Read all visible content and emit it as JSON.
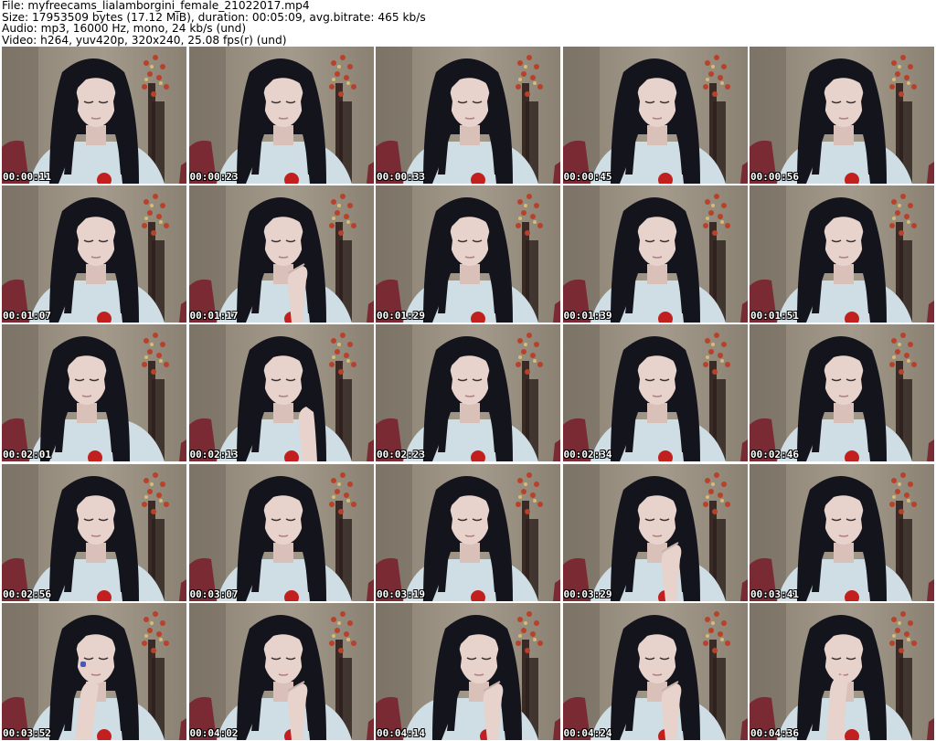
{
  "header": {
    "file_line": "File: myfreecams_lialamborgini_female_21022017.mp4",
    "size_line": "Size: 17953509 bytes (17.12 MiB), duration: 00:05:09, avg.bitrate: 465 kb/s",
    "audio_line": "Audio: mp3, 16000 Hz, mono, 24 kb/s (und)",
    "video_line": "Video: h264, yuv420p, 320x240, 25.08 fps(r) (und)"
  },
  "frames": [
    {
      "time": "00:00:11",
      "hand": "none",
      "tilt": 0
    },
    {
      "time": "00:00:23",
      "hand": "none",
      "tilt": 0
    },
    {
      "time": "00:00:33",
      "hand": "none",
      "tilt": 0
    },
    {
      "time": "00:00:45",
      "hand": "none",
      "tilt": 0
    },
    {
      "time": "00:00:56",
      "hand": "none",
      "tilt": 0
    },
    {
      "time": "00:01:07",
      "hand": "none",
      "tilt": 0
    },
    {
      "time": "00:01:17",
      "hand": "chin",
      "tilt": 0
    },
    {
      "time": "00:01:29",
      "hand": "none",
      "tilt": 0
    },
    {
      "time": "00:01:39",
      "hand": "none",
      "tilt": 0
    },
    {
      "time": "00:01:51",
      "hand": "none",
      "tilt": 0
    },
    {
      "time": "00:02:01",
      "hand": "none",
      "tilt": -1
    },
    {
      "time": "00:02:13",
      "hand": "hair",
      "tilt": 0
    },
    {
      "time": "00:02:23",
      "hand": "none",
      "tilt": 0
    },
    {
      "time": "00:02:34",
      "hand": "none",
      "tilt": 0
    },
    {
      "time": "00:02:46",
      "hand": "none",
      "tilt": 0
    },
    {
      "time": "00:02:56",
      "hand": "none",
      "tilt": 0
    },
    {
      "time": "00:03:07",
      "hand": "none",
      "tilt": 0
    },
    {
      "time": "00:03:19",
      "hand": "none",
      "tilt": 0
    },
    {
      "time": "00:03:29",
      "hand": "chin",
      "tilt": 0
    },
    {
      "time": "00:03:41",
      "hand": "none",
      "tilt": 0
    },
    {
      "time": "00:03:52",
      "hand": "mouth",
      "tilt": 0
    },
    {
      "time": "00:04:02",
      "hand": "chin",
      "tilt": 0
    },
    {
      "time": "00:04:14",
      "hand": "chin",
      "tilt": 1
    },
    {
      "time": "00:04:24",
      "hand": "chin",
      "tilt": 0
    },
    {
      "time": "00:04:36",
      "hand": "cheek",
      "tilt": 0
    }
  ],
  "colors": {
    "wall": "#8a8173",
    "wall_light": "#a39a8b",
    "hair": "#14141c",
    "skin": "#e7d2cc",
    "shirt": "#cfdde4",
    "logo": "#c2201f",
    "flower": "#b8412a",
    "chair": "#7a2a33"
  }
}
